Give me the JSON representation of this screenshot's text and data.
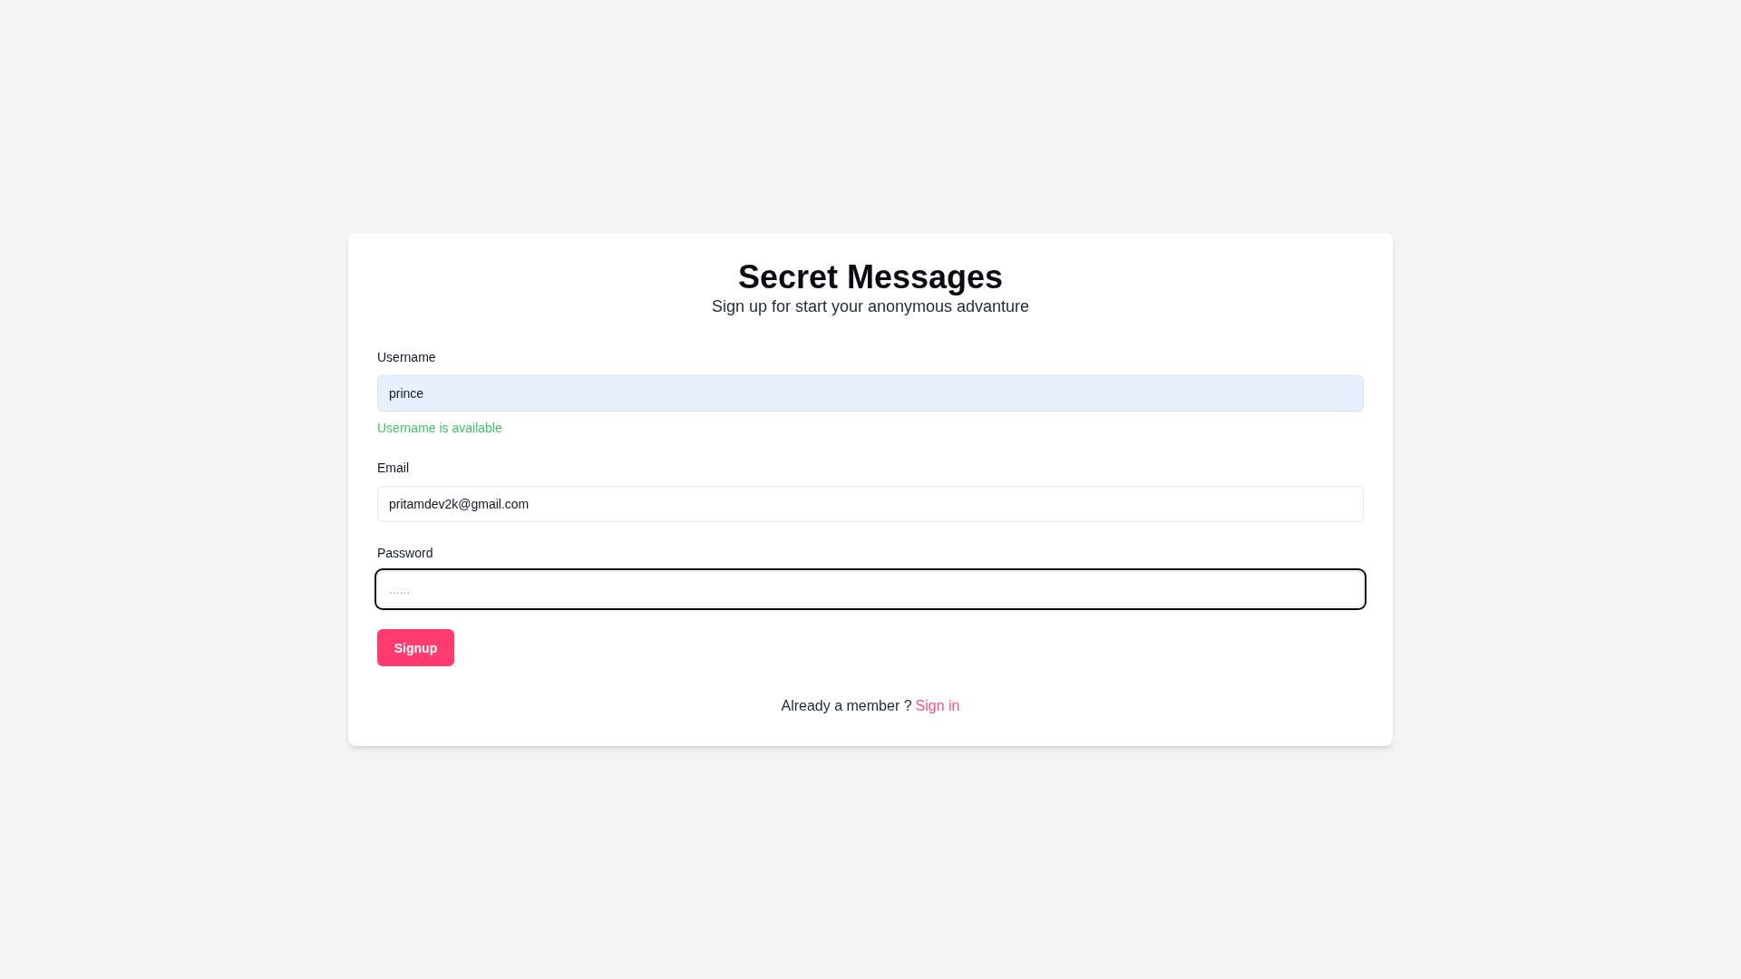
{
  "card": {
    "title": "Secret Messages",
    "subtitle": "Sign up for start your anonymous advanture",
    "fields": [
      {
        "label": "Username",
        "value": "prince",
        "autofilled": true,
        "focused": false,
        "message": {
          "text": "Username is available",
          "kind": "success"
        }
      },
      {
        "label": "Email",
        "value": "pritamdev2k@gmail.com",
        "autofilled": false,
        "focused": false
      },
      {
        "label": "Password",
        "placeholder": "......",
        "autofilled": false,
        "focused": true
      }
    ],
    "submit_button": "Signup",
    "footer": {
      "text": "Already a member ?",
      "link": "Sign in"
    }
  }
}
